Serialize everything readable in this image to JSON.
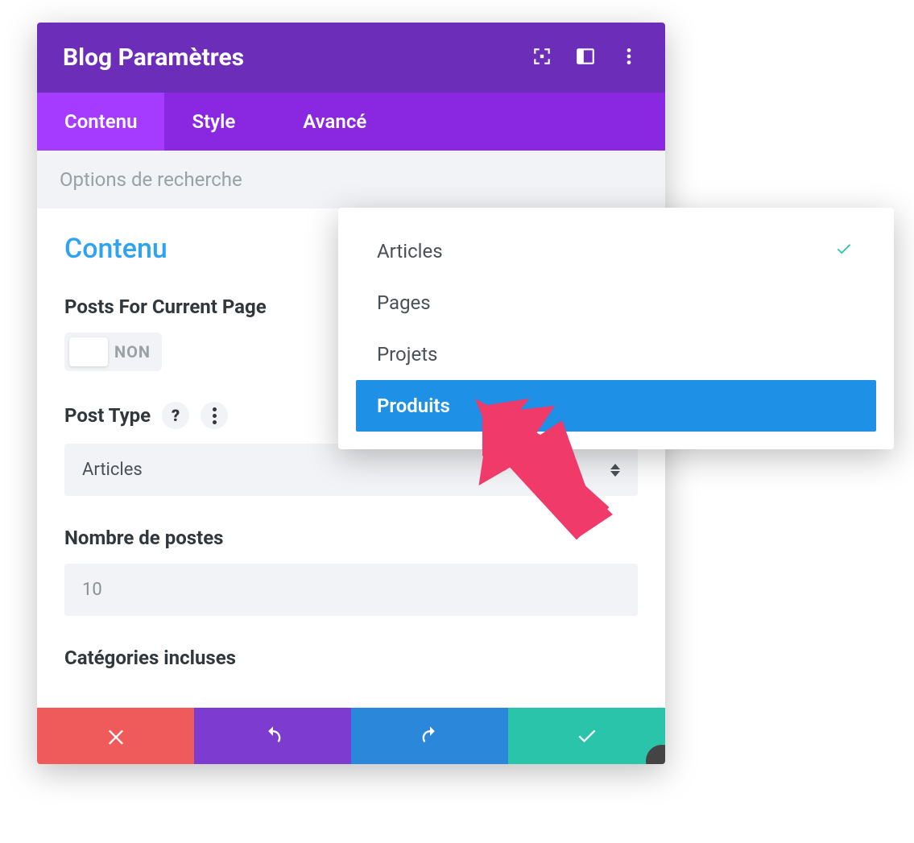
{
  "header": {
    "title": "Blog Paramètres"
  },
  "tabs": {
    "content": "Contenu",
    "style": "Style",
    "advanced": "Avancé"
  },
  "search": {
    "placeholder": "Options de recherche"
  },
  "section_title": "Contenu",
  "fields": {
    "posts_for_page": {
      "label": "Posts For Current Page",
      "toggle_state": "NON"
    },
    "post_type": {
      "label": "Post Type",
      "selected": "Articles"
    },
    "num_posts": {
      "label": "Nombre de postes",
      "value": "10"
    },
    "categories": {
      "label": "Catégories incluses"
    }
  },
  "dropdown": {
    "items": {
      "0": "Articles",
      "1": "Pages",
      "2": "Projets",
      "3": "Produits"
    }
  }
}
